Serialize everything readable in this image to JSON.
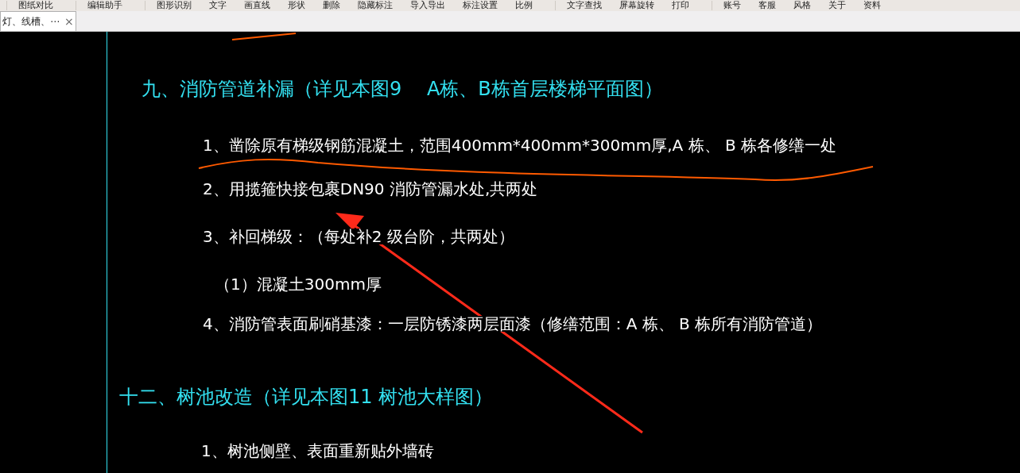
{
  "toolbar": {
    "groups": [
      [
        "图纸对比"
      ],
      [
        "编辑助手"
      ],
      [
        "图形识别",
        "文字",
        "画直线",
        "形状",
        "删除",
        "隐藏标注",
        "导入导出",
        "标注设置",
        "比例"
      ],
      [
        "文字查找",
        "屏幕旋转",
        "打印"
      ],
      [
        "账号",
        "客服",
        "风格",
        "关于",
        "资料"
      ]
    ]
  },
  "tabs": [
    {
      "label": "灯、线槽、⋯",
      "close": "×",
      "selected": true
    }
  ],
  "drawing": {
    "lines": [
      {
        "kind": "heading",
        "text": "九、消防管道补漏（详见本图9　 A栋、B栋首层楼梯平面图）"
      },
      {
        "kind": "item",
        "text": "1、凿除原有梯级钢筋混凝土，范围400mm*400mm*300mm厚,A 栋、 B 栋各修缮一处"
      },
      {
        "kind": "item",
        "text": "2、用揽箍快接包裹DN90 消防管漏水处,共两处"
      },
      {
        "kind": "item",
        "text": "3、补回梯级：（每处补2 级台阶，共两处）"
      },
      {
        "kind": "subitem",
        "text": "（1）混凝土300mm厚"
      },
      {
        "kind": "item",
        "text": "4、消防管表面刷硝基漆：一层防锈漆两层面漆（修缮范围：A 栋、 B 栋所有消防管道）"
      },
      {
        "kind": "heading",
        "text": "十二、树池改造（详见本图11  树池大样图）"
      },
      {
        "kind": "item",
        "text": "1、树池侧壁、表面重新贴外墙砖"
      }
    ]
  }
}
